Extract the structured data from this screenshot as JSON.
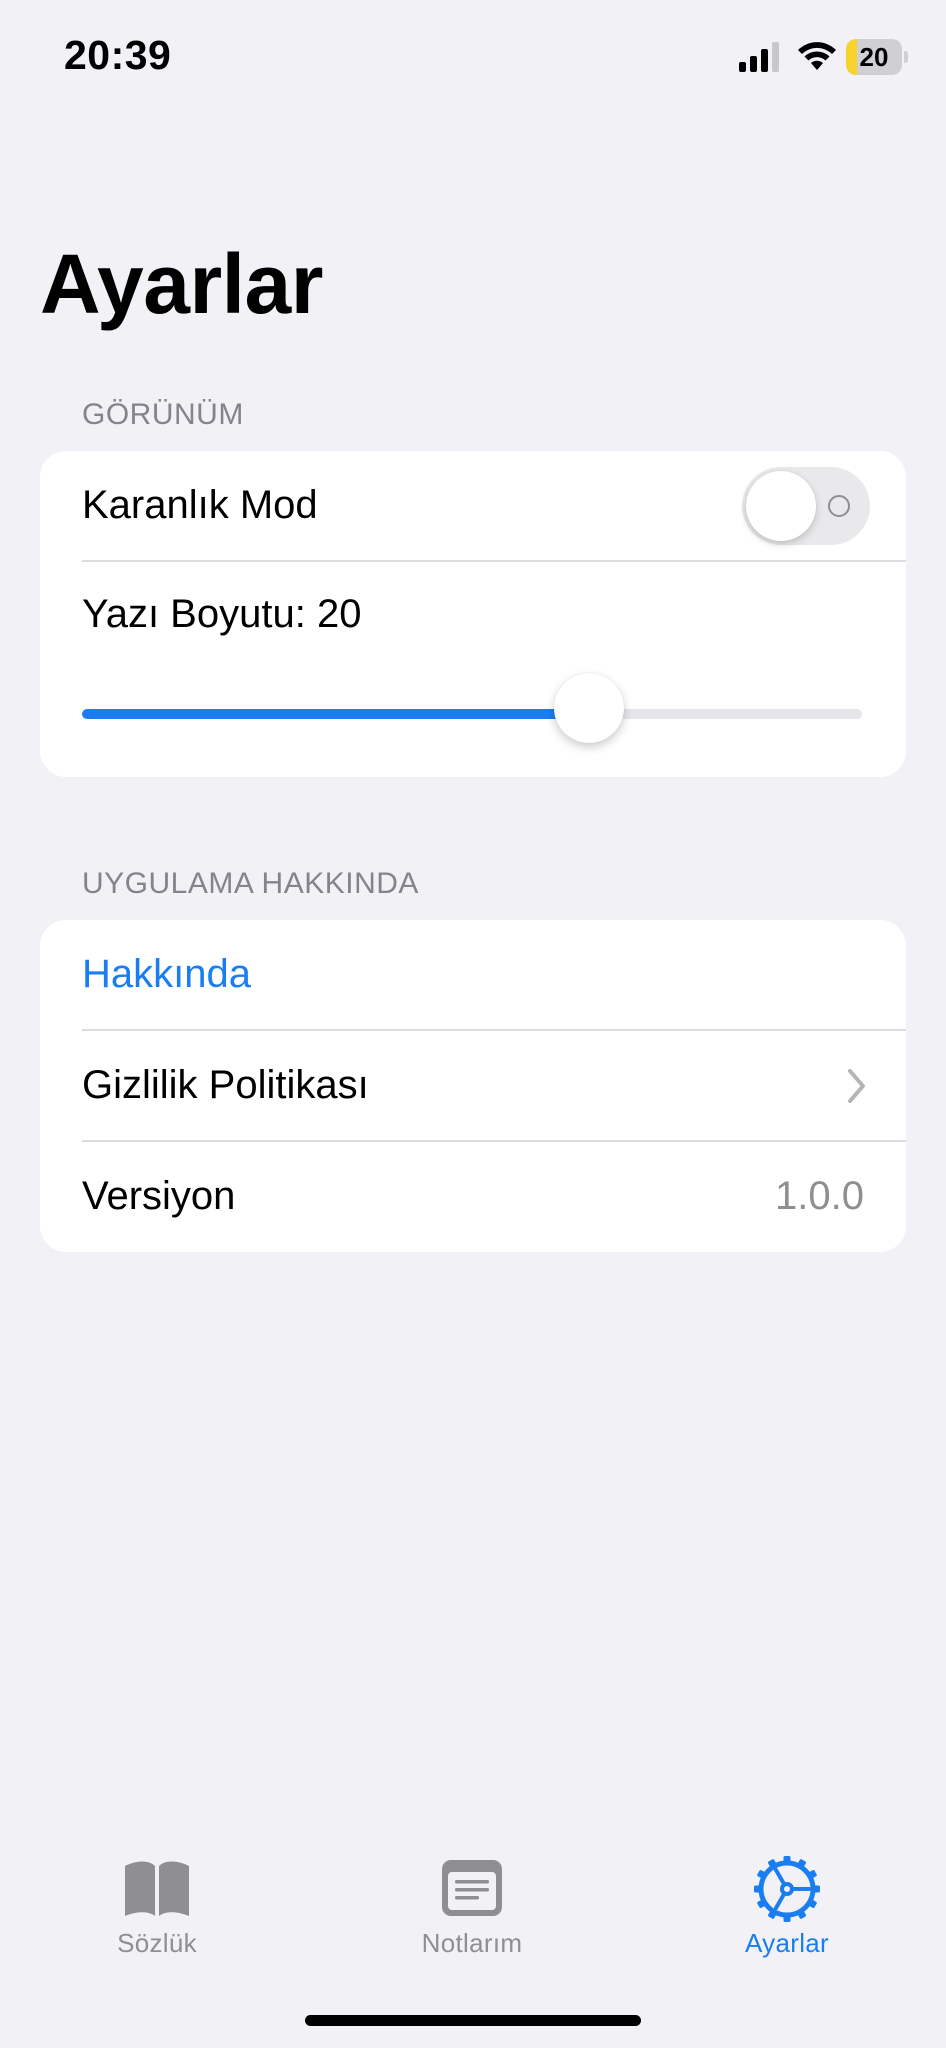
{
  "status_bar": {
    "time": "20:39",
    "battery_level": "20",
    "icons": [
      "signal-icon",
      "wifi-icon",
      "battery-icon"
    ]
  },
  "page": {
    "title": "Ayarlar"
  },
  "appearance_section": {
    "header": "GÖRÜNÜM",
    "dark_mode_label": "Karanlık Mod",
    "dark_mode_on": false,
    "font_size_label": "Yazı Boyutu: 20",
    "font_size_slider_fraction": 0.65
  },
  "about_section": {
    "header": "UYGULAMA HAKKINDA",
    "about_label": "Hakkında",
    "privacy_label": "Gizlilik Politikası",
    "version_label": "Versiyon",
    "version_value": "1.0.0"
  },
  "tab_bar": {
    "tabs": [
      {
        "label": "Sözlük",
        "icon": "book-icon",
        "active": false
      },
      {
        "label": "Notlarım",
        "icon": "notes-icon",
        "active": false
      },
      {
        "label": "Ayarlar",
        "icon": "gear-icon",
        "active": true
      }
    ]
  },
  "colors": {
    "accent": "#1a7ef2",
    "background": "#f1f1f6",
    "inactive_tab": "#8e8e93",
    "battery_low": "#f8d32b"
  }
}
